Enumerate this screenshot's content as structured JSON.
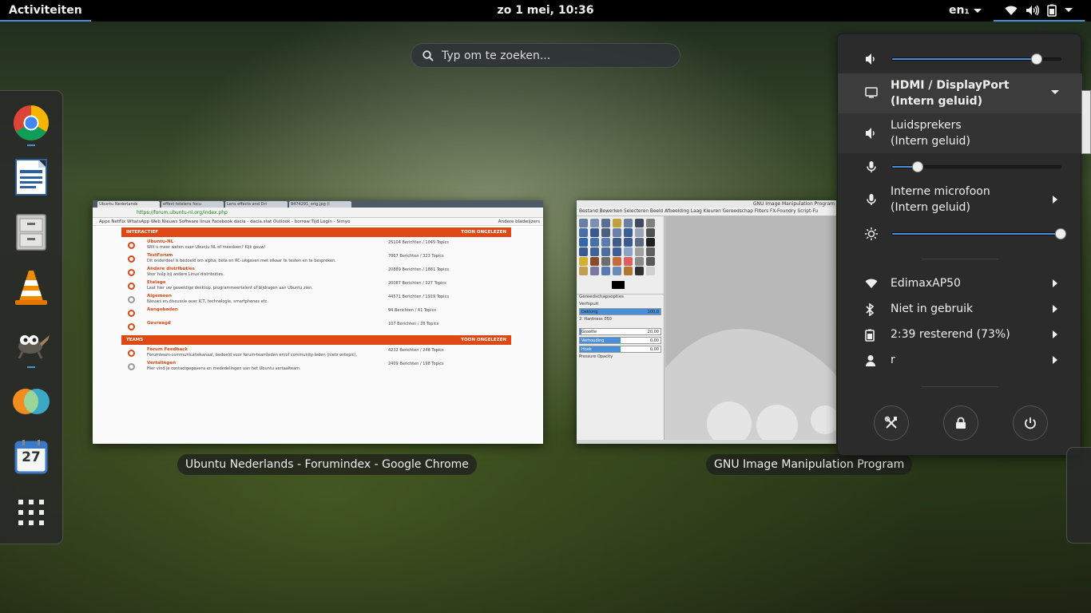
{
  "topbar": {
    "activities": "Activiteiten",
    "clock": "zo  1 mei, 10:36",
    "keyboard": "en₁"
  },
  "search": {
    "placeholder": "Typ om te zoeken..."
  },
  "dash": {
    "apps": [
      {
        "name": "Google Chrome",
        "icon": "chrome-icon",
        "running": true
      },
      {
        "name": "LibreOffice Writer",
        "icon": "writer-icon",
        "running": false
      },
      {
        "name": "Files",
        "icon": "file-cabinet-icon",
        "running": false
      },
      {
        "name": "VLC",
        "icon": "vlc-cone-icon",
        "running": false
      },
      {
        "name": "GIMP",
        "icon": "gimp-icon",
        "running": true
      },
      {
        "name": "App",
        "icon": "circles-icon",
        "running": false
      },
      {
        "name": "Calendar",
        "icon": "calendar-icon",
        "running": false,
        "day": "27"
      },
      {
        "name": "Show Applications",
        "icon": "app-grid-icon",
        "running": false
      }
    ]
  },
  "windows": [
    {
      "caption": "Ubuntu Nederlands - Forumindex - Google Chrome",
      "tabs": [
        "Ubuntu Nederlands",
        "effect telelens focu",
        "Lens effects and Dri",
        "9474291_orig.jpg (i"
      ],
      "url": "https://forum.ubuntu-nl.org/index.php",
      "bookmarks": "Apps   Netflix   WhatsApp Web   Nieuws   Software   linux   Facebook   dacia - dacia.stat   Outlook - borrow   Tijd   Login - Simyo",
      "other_bookmarks": "Andere bladwijzers",
      "sections": [
        {
          "title": "INTERACTIEF",
          "action": "TOON ONGELEZEN",
          "rows": [
            {
              "title": "Ubuntu-NL",
              "desc": "Wilt u meer weten over Ubuntu NL of meedoen? Kijk gauw!",
              "counts": "25104 Berichten / 1045 Topics"
            },
            {
              "title": "TestForum",
              "desc": "Dit onderdeel is bedoeld om alpha, bèta en RC-uitgaven met elkaar te testen en te bespreken.",
              "counts": "7067 Berichten / 323 Topics"
            },
            {
              "title": "Andere distributies",
              "desc": "Voor hulp bij andere Linux-distributies.",
              "counts": "20889 Berichten / 1881 Topics"
            },
            {
              "title": "Etalage",
              "desc": "Laat hier uw geweldige desktop, programmeertalent of bijdragen aan Ubuntu zien.",
              "counts": "20087 Berichten / 327 Topics"
            },
            {
              "title": "Algemeen",
              "desc": "Nieuws en discussie over ICT, technologie, smartphones etc.",
              "counts": "44571 Berichten / 1919 Topics"
            },
            {
              "title": "Aangeboden",
              "desc": "",
              "counts": "94 Berichten / 41 Topics"
            },
            {
              "title": "Gevraagd",
              "desc": "",
              "counts": "107 Berichten / 28 Topics"
            }
          ]
        },
        {
          "title": "TEAMS",
          "action": "TOON ONGELEZEN",
          "rows": [
            {
              "title": "Forum Feedback",
              "desc": "Forumteam-communicatiekanaal, bedoeld voor forum-teamleden en/of community-leden (niets ontopic).",
              "counts": "4232 Berichten / 248 Topics"
            },
            {
              "title": "Vertalingen",
              "desc": "Hier vind je contactgegevens en mededelingen van het Ubuntu vertaalteam.",
              "counts": "2409 Berichten / 198 Topics"
            }
          ]
        }
      ]
    },
    {
      "caption": "GNU Image Manipulation Program",
      "title": "GNU Image Manipulation Program",
      "menu": "Bestand  Bewerken  Selecteren  Beeld  Afbeelding  Laag  Kleuren  Gereedschap  Filters  FX-Foundry  Script-Fu",
      "tool_options_tab": "Gereedschapsopties",
      "tool_name": "Verfspuit",
      "options": [
        {
          "label": "Dekking",
          "value": "100,0",
          "fill": 1.0
        },
        {
          "label": "Grootte",
          "value": "20,00",
          "fill": 0.0
        },
        {
          "label": "Verhouding",
          "value": "0,00",
          "fill": 0.5
        },
        {
          "label": "Hoek",
          "value": "0,00",
          "fill": 0.5
        }
      ],
      "brush": "2. Hardness 050",
      "dynamics": "Pressure Opacity"
    }
  ],
  "system_menu": {
    "volume": {
      "level": 0.86,
      "icon": "speaker-low-icon"
    },
    "output_selector": {
      "label": "HDMI / DisplayPort",
      "sub": "(Intern geluid)",
      "icon": "monitor-icon"
    },
    "output_option": {
      "label": "Luidsprekers",
      "sub": "(Intern geluid)",
      "icon": "speaker-icon"
    },
    "mic": {
      "level": 0.15,
      "icon": "microphone-icon"
    },
    "mic_selector": {
      "label": "Interne microfoon",
      "sub": "(Intern geluid)",
      "icon": "microphone-icon"
    },
    "brightness": {
      "level": 1.0,
      "icon": "brightness-icon"
    },
    "items": [
      {
        "label": "EdimaxAP50",
        "icon": "wifi-icon"
      },
      {
        "label": "Niet in gebruik",
        "icon": "bluetooth-icon"
      },
      {
        "label": "2:39 resterend (73%)",
        "icon": "battery-icon"
      },
      {
        "label": "r",
        "icon": "user-icon"
      }
    ],
    "buttons": [
      "settings-button",
      "lock-button",
      "power-button"
    ]
  },
  "colors": {
    "accent": "#4a90d9",
    "ubuntu_orange": "#dd4814",
    "menu_bg": "#2b2b2b"
  }
}
